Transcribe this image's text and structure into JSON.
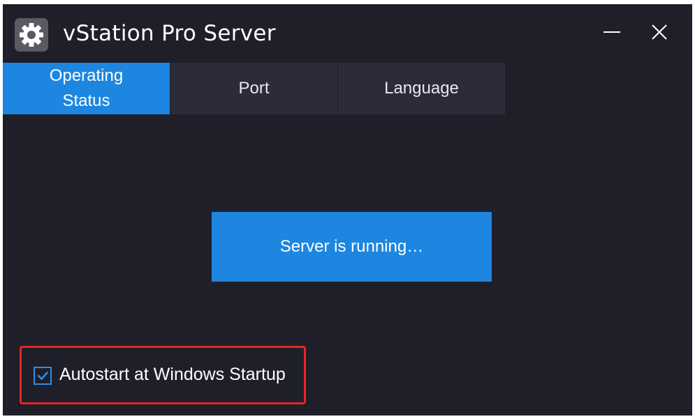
{
  "window": {
    "title": "vStation Pro Server",
    "icons": {
      "app": "gear-icon",
      "minimize": "minimize-icon",
      "close": "close-icon"
    }
  },
  "tabs": [
    {
      "label": "Operating Status",
      "active": true
    },
    {
      "label": "Port",
      "active": false
    },
    {
      "label": "Language",
      "active": false
    }
  ],
  "status": {
    "text": "Server is running…"
  },
  "autostart": {
    "label": "Autostart at Windows Startup",
    "checked": true
  },
  "colors": {
    "background": "#1f1f29",
    "tab": "#2b2b3a",
    "accent": "#1c86e0",
    "highlight": "#e8242a"
  }
}
